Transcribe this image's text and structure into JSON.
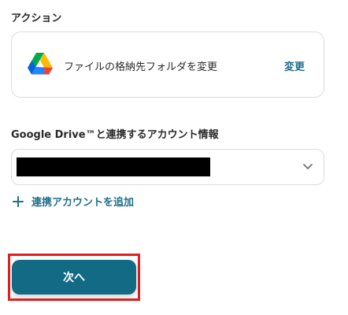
{
  "action_section": {
    "label": "アクション",
    "action_name": "ファイルの格納先フォルダを変更",
    "change_link": "変更",
    "logo_icon": "google-drive-icon"
  },
  "account_section": {
    "label": "Google Drive™と連携するアカウント情報",
    "selected_account_redacted": true,
    "dropdown_icon": "chevron-down-icon",
    "add_account_label": "連携アカウントを追加",
    "add_icon": "plus-icon"
  },
  "footer": {
    "next_label": "次へ",
    "highlight_color": "#e02020"
  },
  "colors": {
    "accent": "#1f6f8b",
    "button": "#136a85",
    "border": "#d9dce1"
  }
}
